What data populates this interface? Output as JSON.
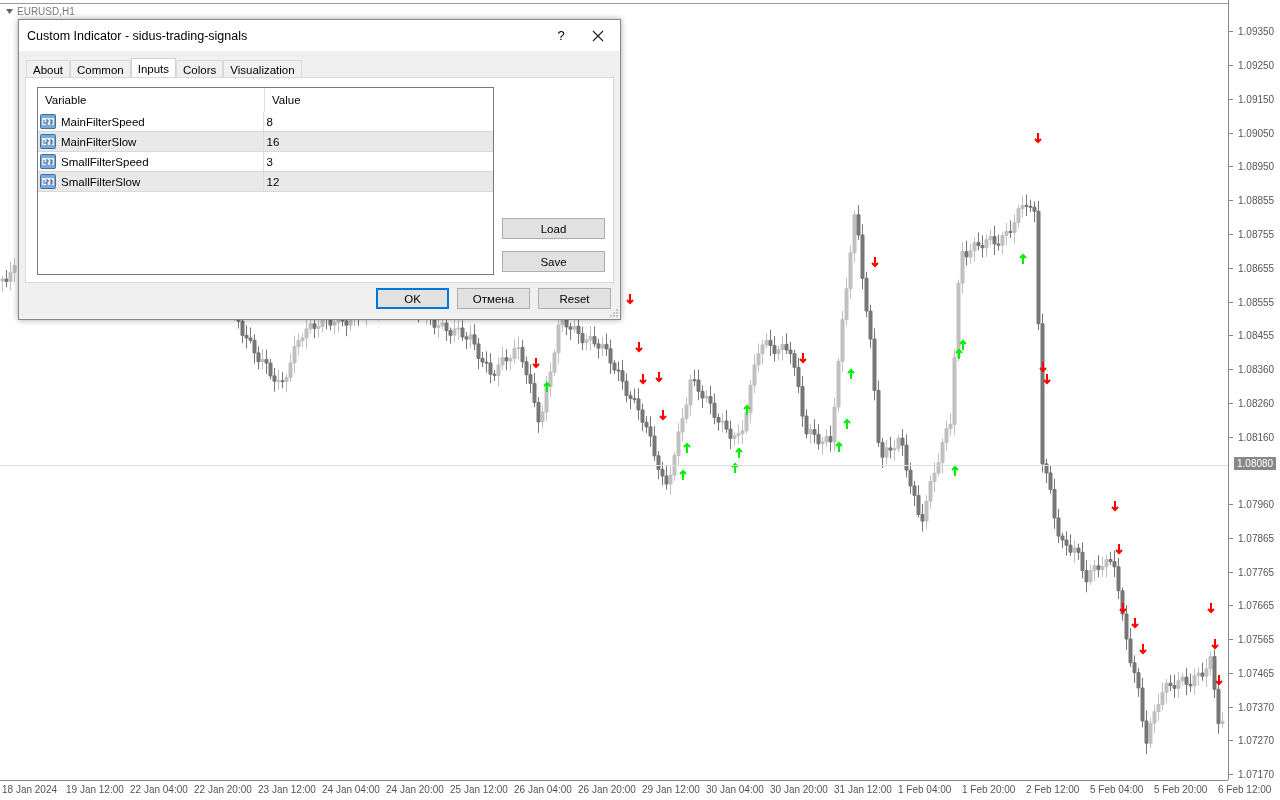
{
  "chart": {
    "symbol": "EURUSD,H1",
    "price_labels": [
      "1.09350",
      "1.09250",
      "1.09150",
      "1.09050",
      "1.08950",
      "1.08855",
      "1.08755",
      "1.08655",
      "1.08555",
      "1.08455",
      "1.08360",
      "1.08260",
      "1.08160",
      "1.07960",
      "1.07865",
      "1.07765",
      "1.07665",
      "1.07565",
      "1.07465",
      "1.07370",
      "1.07270",
      "1.07170"
    ],
    "current_price": "1.08080",
    "time_labels": [
      "18 Jan 2024",
      "19 Jan 12:00",
      "22 Jan 04:00",
      "22 Jan 20:00",
      "23 Jan 12:00",
      "24 Jan 04:00",
      "24 Jan 20:00",
      "25 Jan 12:00",
      "26 Jan 04:00",
      "26 Jan 20:00",
      "29 Jan 12:00",
      "30 Jan 04:00",
      "30 Jan 20:00",
      "31 Jan 12:00",
      "1 Feb 04:00",
      "1 Feb 20:00",
      "2 Feb 12:00",
      "5 Feb 04:00",
      "5 Feb 20:00",
      "6 Feb 12:00"
    ]
  },
  "dialog": {
    "title": "Custom Indicator - sidus-trading-signals",
    "help": "?",
    "tabs": [
      {
        "label": "About",
        "selected": false
      },
      {
        "label": "Common",
        "selected": false
      },
      {
        "label": "Inputs",
        "selected": true
      },
      {
        "label": "Colors",
        "selected": false
      },
      {
        "label": "Visualization",
        "selected": false
      }
    ],
    "columns": [
      "Variable",
      "Value"
    ],
    "rows": [
      {
        "variable": "MainFilterSpeed",
        "value": "8"
      },
      {
        "variable": "MainFilterSlow",
        "value": "16"
      },
      {
        "variable": "SmallFilterSpeed",
        "value": "3"
      },
      {
        "variable": "SmallFilterSlow",
        "value": "12"
      }
    ],
    "side_buttons": [
      "Load",
      "Save"
    ],
    "buttons": [
      {
        "label": "OK",
        "default": true
      },
      {
        "label": "Отмена",
        "default": false
      },
      {
        "label": "Reset",
        "default": false
      }
    ]
  }
}
